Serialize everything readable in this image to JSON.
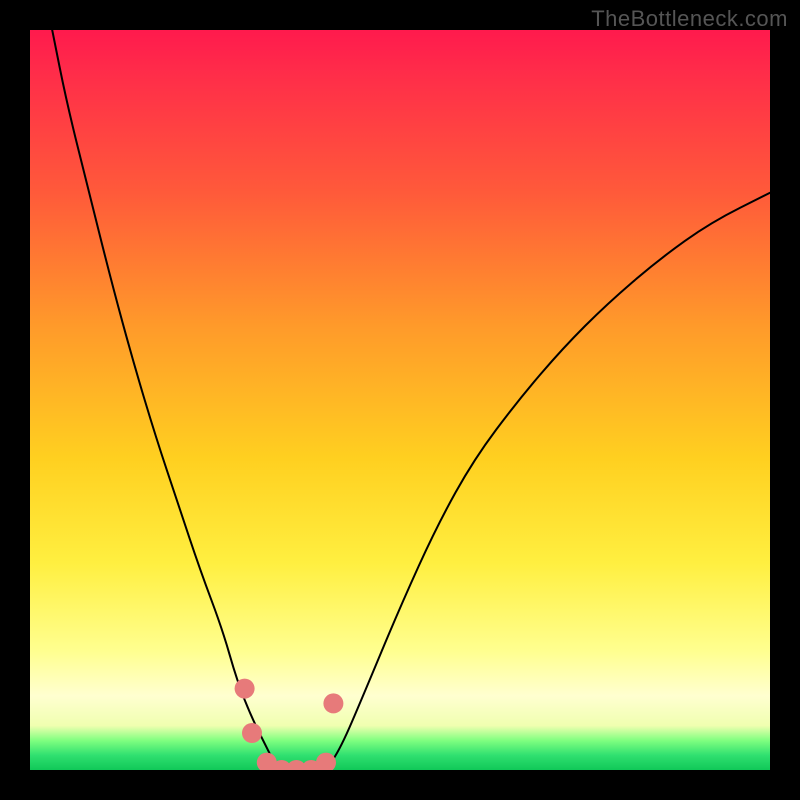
{
  "watermark": "TheBottleneck.com",
  "chart_data": {
    "type": "line",
    "title": "",
    "xlabel": "",
    "ylabel": "",
    "xlim": [
      0,
      100
    ],
    "ylim": [
      0,
      100
    ],
    "background_gradient": {
      "orientation": "vertical",
      "stops": [
        {
          "pos": 0,
          "color": "#ff1a4d"
        },
        {
          "pos": 22,
          "color": "#ff5a3a"
        },
        {
          "pos": 40,
          "color": "#ff9a2a"
        },
        {
          "pos": 58,
          "color": "#ffd020"
        },
        {
          "pos": 72,
          "color": "#ffef40"
        },
        {
          "pos": 84,
          "color": "#ffff90"
        },
        {
          "pos": 94,
          "color": "#f0ffb0"
        },
        {
          "pos": 96,
          "color": "#80ff80"
        },
        {
          "pos": 100,
          "color": "#10c858"
        }
      ]
    },
    "series": [
      {
        "name": "left-branch",
        "x": [
          3,
          5,
          8,
          11,
          14,
          17,
          20,
          23,
          26,
          28,
          30,
          32,
          33,
          34
        ],
        "y": [
          100,
          90,
          78,
          66,
          55,
          45,
          36,
          27,
          19,
          12,
          7,
          3,
          1,
          0
        ]
      },
      {
        "name": "right-branch",
        "x": [
          40,
          42,
          45,
          50,
          55,
          60,
          66,
          72,
          78,
          85,
          92,
          100
        ],
        "y": [
          0,
          3,
          10,
          22,
          33,
          42,
          50,
          57,
          63,
          69,
          74,
          78
        ]
      },
      {
        "name": "valley-markers",
        "type": "scatter",
        "x": [
          29,
          30,
          32,
          34,
          36,
          38,
          40,
          41
        ],
        "y": [
          11,
          5,
          1,
          0,
          0,
          0,
          1,
          9
        ],
        "color": "#e77a7a",
        "marker_size": 10
      }
    ]
  }
}
